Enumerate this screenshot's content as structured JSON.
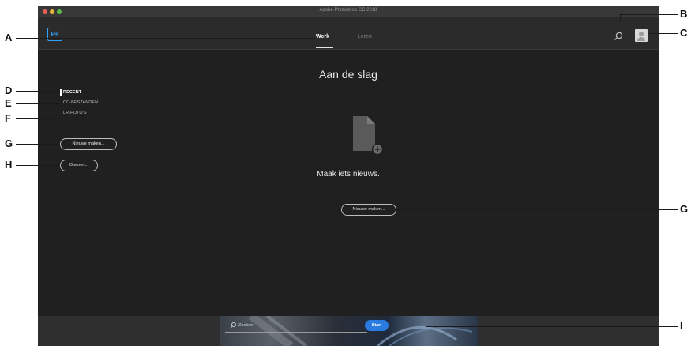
{
  "window": {
    "title": "Adobe Photoshop CC 2018"
  },
  "app": {
    "logo_text": "Ps"
  },
  "tabs": [
    {
      "label": "Werk",
      "active": true
    },
    {
      "label": "Leren",
      "active": false
    }
  ],
  "header": {
    "search_icon": "search-icon",
    "avatar_icon": "user-avatar-icon"
  },
  "sidebar": {
    "items": [
      {
        "label": "RECENT",
        "active": true
      },
      {
        "label": "CC-BESTANDEN"
      },
      {
        "label": "LR-FOTO'S"
      }
    ],
    "new_button": "Nieuwe maken...",
    "open_button": "Openen..."
  },
  "main": {
    "title": "Aan de slag",
    "icon": "new-document-icon",
    "subtitle": "Maak iets nieuws.",
    "new_button": "Nieuwe maken..."
  },
  "bottom": {
    "search_placeholder": "Zoeken",
    "start_button": "Start"
  },
  "callouts": [
    "A",
    "B",
    "C",
    "D",
    "E",
    "F",
    "G",
    "H",
    "G",
    "I"
  ],
  "colors": {
    "background": "#202020",
    "accent": "#2fa3f7",
    "start_button": "#2a7be0"
  }
}
